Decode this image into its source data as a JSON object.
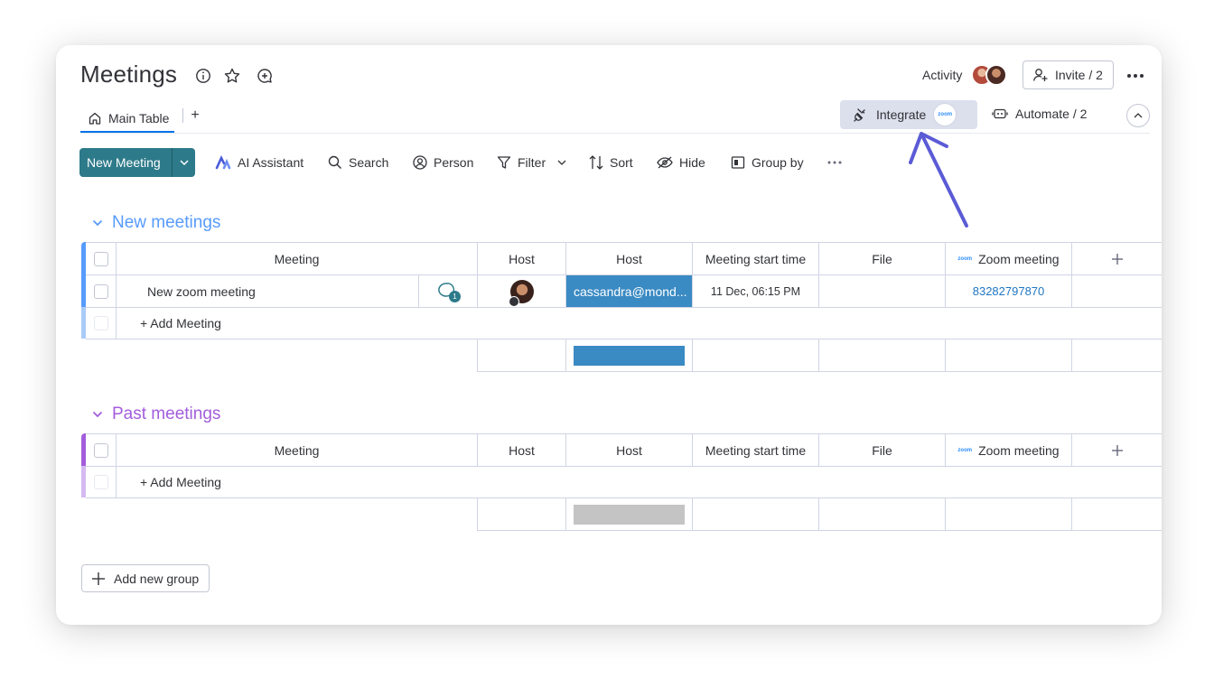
{
  "board": {
    "title": "Meetings",
    "activity_label": "Activity",
    "invite_label": "Invite / 2",
    "tabs": [
      {
        "label": "Main Table"
      }
    ],
    "integrate_label": "Integrate",
    "integrate_badge": "zoom",
    "automate_label": "Automate / 2"
  },
  "toolbar": {
    "new_item_label": "New Meeting",
    "ai_label": "AI Assistant",
    "search_label": "Search",
    "person_label": "Person",
    "filter_label": "Filter",
    "sort_label": "Sort",
    "hide_label": "Hide",
    "group_by_label": "Group by"
  },
  "columns": {
    "meeting": "Meeting",
    "host1": "Host",
    "host2": "Host",
    "start": "Meeting start time",
    "file": "File",
    "zoom_prefix": "zoom",
    "zoom": "Zoom meeting"
  },
  "groups": [
    {
      "title": "New meetings",
      "color": "#579bfc",
      "rows": [
        {
          "name": "New zoom meeting",
          "updates_count": "1",
          "host_email": "cassandra@mond...",
          "start_time": "11 Dec, 06:15 PM",
          "zoom_id": "83282797870"
        }
      ],
      "add_label": "+ Add Meeting",
      "summary_color": "#3a8ac3"
    },
    {
      "title": "Past meetings",
      "color": "#a25ddc",
      "rows": [],
      "add_label": "+ Add Meeting",
      "summary_color": "#c4c4c4"
    }
  ],
  "add_group_label": "Add new group",
  "colors": {
    "primary": "#2d7a8a",
    "status_blue": "#3a8ac3",
    "link": "#1f76c2",
    "arrow": "#5b5bd6"
  }
}
